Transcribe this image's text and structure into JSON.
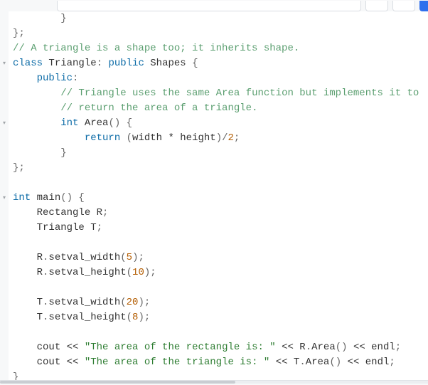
{
  "top": {
    "search_placeholder": "",
    "search_value": ""
  },
  "code": {
    "lines": [
      {
        "foldable": false,
        "indent": 2,
        "tokens": [
          {
            "t": "}",
            "c": "punct"
          }
        ]
      },
      {
        "foldable": false,
        "indent": 0,
        "tokens": [
          {
            "t": "};",
            "c": "punct"
          }
        ]
      },
      {
        "foldable": false,
        "indent": 0,
        "tokens": [
          {
            "t": "// A triangle is a shape too; it inherits shape.",
            "c": "cmnt"
          }
        ]
      },
      {
        "foldable": true,
        "indent": 0,
        "tokens": [
          {
            "t": "class ",
            "c": "kw"
          },
          {
            "t": "Triangle",
            "c": "id"
          },
          {
            "t": ": ",
            "c": "punct"
          },
          {
            "t": "public ",
            "c": "kw"
          },
          {
            "t": "Shapes ",
            "c": "id"
          },
          {
            "t": "{",
            "c": "punct"
          }
        ]
      },
      {
        "foldable": false,
        "indent": 1,
        "tokens": [
          {
            "t": "public",
            "c": "kw"
          },
          {
            "t": ":",
            "c": "punct"
          }
        ]
      },
      {
        "foldable": false,
        "indent": 2,
        "tokens": [
          {
            "t": "// Triangle uses the same Area function but implements it to",
            "c": "cmnt"
          }
        ]
      },
      {
        "foldable": false,
        "indent": 2,
        "tokens": [
          {
            "t": "// return the area of a triangle.",
            "c": "cmnt"
          }
        ]
      },
      {
        "foldable": true,
        "indent": 2,
        "tokens": [
          {
            "t": "int ",
            "c": "kw"
          },
          {
            "t": "Area",
            "c": "id"
          },
          {
            "t": "() {",
            "c": "punct"
          }
        ]
      },
      {
        "foldable": false,
        "indent": 3,
        "tokens": [
          {
            "t": "return ",
            "c": "kw"
          },
          {
            "t": "(",
            "c": "punct"
          },
          {
            "t": "width ",
            "c": "id"
          },
          {
            "t": "* ",
            "c": "op"
          },
          {
            "t": "height",
            "c": "id"
          },
          {
            "t": ")/",
            "c": "punct"
          },
          {
            "t": "2",
            "c": "num"
          },
          {
            "t": ";",
            "c": "punct"
          }
        ]
      },
      {
        "foldable": false,
        "indent": 2,
        "tokens": [
          {
            "t": "}",
            "c": "punct"
          }
        ]
      },
      {
        "foldable": false,
        "indent": 0,
        "tokens": [
          {
            "t": "};",
            "c": "punct"
          }
        ]
      },
      {
        "foldable": false,
        "indent": 0,
        "tokens": []
      },
      {
        "foldable": true,
        "indent": 0,
        "tokens": [
          {
            "t": "int ",
            "c": "kw"
          },
          {
            "t": "main",
            "c": "id"
          },
          {
            "t": "() {",
            "c": "punct"
          }
        ]
      },
      {
        "foldable": false,
        "indent": 1,
        "tokens": [
          {
            "t": "Rectangle R",
            "c": "id"
          },
          {
            "t": ";",
            "c": "punct"
          }
        ]
      },
      {
        "foldable": false,
        "indent": 1,
        "tokens": [
          {
            "t": "Triangle T",
            "c": "id"
          },
          {
            "t": ";",
            "c": "punct"
          }
        ]
      },
      {
        "foldable": false,
        "indent": 1,
        "tokens": []
      },
      {
        "foldable": false,
        "indent": 1,
        "tokens": [
          {
            "t": "R",
            "c": "id"
          },
          {
            "t": ".",
            "c": "punct"
          },
          {
            "t": "setval_width",
            "c": "id"
          },
          {
            "t": "(",
            "c": "punct"
          },
          {
            "t": "5",
            "c": "num"
          },
          {
            "t": ");",
            "c": "punct"
          }
        ]
      },
      {
        "foldable": false,
        "indent": 1,
        "tokens": [
          {
            "t": "R",
            "c": "id"
          },
          {
            "t": ".",
            "c": "punct"
          },
          {
            "t": "setval_height",
            "c": "id"
          },
          {
            "t": "(",
            "c": "punct"
          },
          {
            "t": "10",
            "c": "num"
          },
          {
            "t": ");",
            "c": "punct"
          }
        ]
      },
      {
        "foldable": false,
        "indent": 1,
        "tokens": []
      },
      {
        "foldable": false,
        "indent": 1,
        "tokens": [
          {
            "t": "T",
            "c": "id"
          },
          {
            "t": ".",
            "c": "punct"
          },
          {
            "t": "setval_width",
            "c": "id"
          },
          {
            "t": "(",
            "c": "punct"
          },
          {
            "t": "20",
            "c": "num"
          },
          {
            "t": ");",
            "c": "punct"
          }
        ]
      },
      {
        "foldable": false,
        "indent": 1,
        "tokens": [
          {
            "t": "T",
            "c": "id"
          },
          {
            "t": ".",
            "c": "punct"
          },
          {
            "t": "setval_height",
            "c": "id"
          },
          {
            "t": "(",
            "c": "punct"
          },
          {
            "t": "8",
            "c": "num"
          },
          {
            "t": ");",
            "c": "punct"
          }
        ]
      },
      {
        "foldable": false,
        "indent": 1,
        "tokens": []
      },
      {
        "foldable": false,
        "indent": 1,
        "tokens": [
          {
            "t": "cout ",
            "c": "id"
          },
          {
            "t": "<< ",
            "c": "op"
          },
          {
            "t": "\"The area of the rectangle is: \"",
            "c": "str"
          },
          {
            "t": " << ",
            "c": "op"
          },
          {
            "t": "R",
            "c": "id"
          },
          {
            "t": ".",
            "c": "punct"
          },
          {
            "t": "Area",
            "c": "id"
          },
          {
            "t": "() ",
            "c": "punct"
          },
          {
            "t": "<< ",
            "c": "op"
          },
          {
            "t": "endl",
            "c": "id"
          },
          {
            "t": ";",
            "c": "punct"
          }
        ]
      },
      {
        "foldable": false,
        "indent": 1,
        "tokens": [
          {
            "t": "cout ",
            "c": "id"
          },
          {
            "t": "<< ",
            "c": "op"
          },
          {
            "t": "\"The area of the triangle is: \"",
            "c": "str"
          },
          {
            "t": " << ",
            "c": "op"
          },
          {
            "t": "T",
            "c": "id"
          },
          {
            "t": ".",
            "c": "punct"
          },
          {
            "t": "Area",
            "c": "id"
          },
          {
            "t": "() ",
            "c": "punct"
          },
          {
            "t": "<< ",
            "c": "op"
          },
          {
            "t": "endl",
            "c": "id"
          },
          {
            "t": ";",
            "c": "punct"
          }
        ]
      },
      {
        "foldable": false,
        "indent": 0,
        "tokens": [
          {
            "t": "}",
            "c": "punct"
          }
        ]
      }
    ]
  }
}
